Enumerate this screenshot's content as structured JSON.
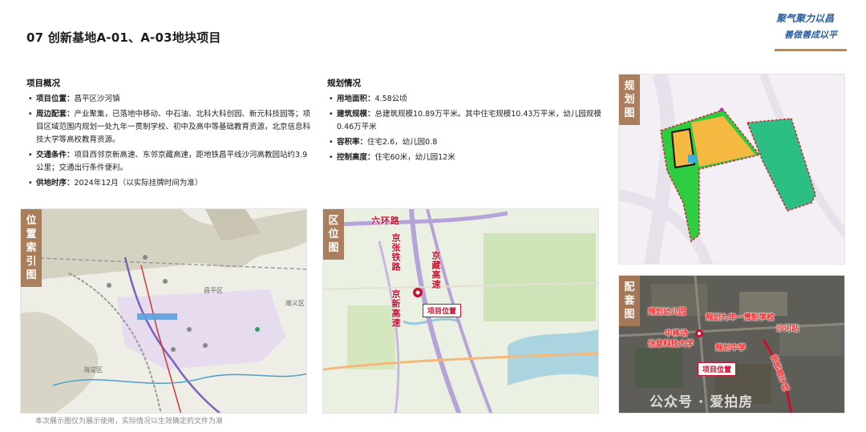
{
  "header": {
    "title": "07 创新基地A-01、A-03地块项目",
    "logo_line1": "聚气聚力以昌",
    "logo_line2": "善做善成以平"
  },
  "overview": {
    "heading": "项目概况",
    "items": [
      {
        "label": "项目位置：",
        "text": "昌平区沙河镇"
      },
      {
        "label": "周边配套：",
        "text": "产业聚集，已落地中移动、中石油、北科大科创园、新元科技园等；项目区域范围内规划一处九年一贯制学校、初中及高中等基础教育资源，北京信息科技大学等高校教育资源。"
      },
      {
        "label": "交通条件：",
        "text": "项目西邻京新高速、东邻京藏高速，距地铁昌平线沙河高教园站约3.9公里；交通出行条件便利。"
      },
      {
        "label": "供地时序：",
        "text": "2024年12月（以实际挂牌时间为准）"
      }
    ]
  },
  "planning": {
    "heading": "规划情况",
    "items": [
      {
        "label": "用地面积：",
        "text": "4.58公顷"
      },
      {
        "label": "建筑规模：",
        "text": "总建筑规模10.89万平米。其中住宅规模10.43万平米，幼儿园规模0.46万平米"
      },
      {
        "label": "容积率：",
        "text": "住宅2.6，幼儿园0.8"
      },
      {
        "label": "控制高度：",
        "text": "住宅60米，幼儿园12米"
      }
    ]
  },
  "panels": {
    "location": {
      "tag": [
        "位",
        "置",
        "索",
        "引",
        "图"
      ],
      "district_changping": "昌平区",
      "district_shunyi": "顺义区",
      "district_haidian": "海淀区"
    },
    "region": {
      "tag": [
        "区",
        "位",
        "图"
      ],
      "ring_road": "六环路",
      "jingzang": "京藏高速",
      "jingxin": "京新高速",
      "rail": "京张铁路",
      "pin": "项目位置"
    },
    "plan": {
      "tag": [
        "规",
        "划",
        "图"
      ]
    },
    "support": {
      "tag": [
        "配",
        "套",
        "图"
      ],
      "kindergarten": "规划幼儿园",
      "nine_year_school": "规划九年一贯制学校",
      "shahe_station": "沙河站",
      "cmcc": "中移动",
      "bistu": "信息科技大学",
      "middle_school": "规划中学",
      "metro": "地铁昌平线",
      "pin": "项目位置",
      "watermark": "公众号 · 爱拍房"
    }
  },
  "footnote": "本次展示图仅为展示使用，实际情况以生效确定的文件为准",
  "colors": {
    "accent": "#a87a56",
    "highlight": "#c8102e",
    "logo": "#2a5fa0"
  }
}
